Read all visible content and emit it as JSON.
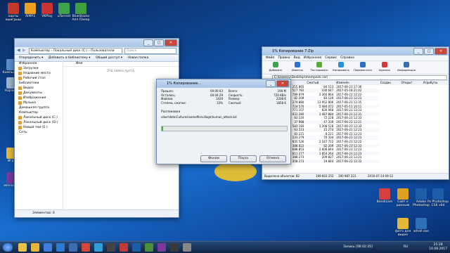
{
  "desktop": {
    "icons": [
      {
        "label": "карты выигрыш",
        "color": "#c0392b"
      },
      {
        "label": "Компьютер",
        "color": "#5b8dc9"
      },
      {
        "label": "Корзина",
        "color": "#9db3c9"
      },
      {
        "label": "AIMP3",
        "color": "#f0a020"
      },
      {
        "label": "VKPlay",
        "color": "#cc3333"
      },
      {
        "label": "uTorrent",
        "color": "#3fa34d"
      },
      {
        "label": "BlueStacks Апп Плеер",
        "color": "#3f9f3f"
      },
      {
        "label": "wtrell.exe",
        "color": "#2d6fb8"
      },
      {
        "label": "Bandicam",
        "color": "#d43f3f"
      },
      {
        "label": "Сайт к данным",
        "color": "#e0a020"
      },
      {
        "label": "Adobe Photoshop",
        "color": "#1d5ea8"
      },
      {
        "label": "Ps Photoshop CS6 x64",
        "color": "#1d5ea8"
      },
      {
        "label": "winrar.exe",
        "color": "#7a3a9a"
      },
      {
        "label": "фото для видео",
        "color": "#e4b73a"
      },
      {
        "label": "Игры",
        "color": "#e4b73a"
      }
    ]
  },
  "explorer": {
    "address": "Компьютер › Локальный диск (C:) › Пользователи",
    "search_placeholder": "Поиск",
    "cmd": {
      "organize": "Упорядочить ▾",
      "library": "Добавить в библиотеку ▾",
      "share": "Общий доступ ▾",
      "new_folder": "Новая папка"
    },
    "nav": [
      {
        "label": "Избранное",
        "header": true
      },
      {
        "label": "Загрузки",
        "header": false
      },
      {
        "label": "Недавние места",
        "header": false
      },
      {
        "label": "Рабочий стол",
        "header": false
      },
      {
        "label": "Библиотеки",
        "header": true
      },
      {
        "label": "Видео",
        "header": false
      },
      {
        "label": "Документы",
        "header": false
      },
      {
        "label": "Изображения",
        "header": false
      },
      {
        "label": "Музыка",
        "header": false
      },
      {
        "label": "Домашняя группа",
        "header": true
      },
      {
        "label": "Компьютер",
        "header": true
      },
      {
        "label": "Локальный диск (C:)",
        "header": false
      },
      {
        "label": "Локальный диск (D:)",
        "header": false
      },
      {
        "label": "Новый том (E:)",
        "header": false
      },
      {
        "label": "Сеть",
        "header": true
      }
    ],
    "col_name": "Имя",
    "empty_text": "Эта папка пуста.",
    "status": "Элементов: 0"
  },
  "copy_dialog": {
    "title": "1% Копирование...",
    "left_rows": [
      [
        "Прошло:",
        "00:00:03"
      ],
      [
        "Осталось:",
        "00:04:29"
      ],
      [
        "Файлов:",
        "1429"
      ],
      [
        "Степень сжатия:",
        "33%"
      ]
    ],
    "right_rows": [
      [
        "Всего:",
        "190 M"
      ],
      [
        "Скорость:",
        "720 KB/s"
      ],
      [
        "Размер:",
        "2208 K"
      ],
      [
        "Сжатый:",
        "1858 K"
      ]
    ],
    "unpack_label": "Распаковка",
    "file_path": "viber\\data\\Cultures\\somefile\\village\\human_attack.bd",
    "progress": 0.01,
    "buttons": {
      "background": "Фоном",
      "pause": "Пауза",
      "cancel": "Отмена"
    }
  },
  "archiver": {
    "title": "1% Копирование 7-Zip",
    "menu": [
      "Файл",
      "Правка",
      "Вид",
      "Избранное",
      "Сервис",
      "Справка"
    ],
    "toolbar": [
      "Добавить",
      "Извлечь",
      "Тестировать",
      "Копировать",
      "Переместить",
      "Удалить",
      "Информация"
    ],
    "path": "C:\\Users\\v\\Desktop\\mempack.rar\\",
    "columns": [
      "Имя",
      "Размер",
      "Сжатый",
      "Изменён",
      "Создан",
      "Открыт",
      "Атрибуты"
    ],
    "rows": [
      [
        "...",
        "255 865",
        "84 153",
        "2017-06-23 17:36"
      ],
      [
        "...",
        "517 782",
        "430 647",
        "2017-05-18 21:42"
      ],
      [
        "...",
        "2 789 879",
        "2 360 864",
        "2017-06-23 12:22"
      ],
      [
        "...",
        "82 209",
        "83 129",
        "2017-06-23 12:23"
      ],
      [
        "...",
        "15 274 880",
        "13 952 806",
        "2017-06-23 12:35"
      ],
      [
        "...",
        "5 724 570",
        "5 484 072",
        "2017-05-11 10:11"
      ],
      [
        "...",
        "771 107",
        "830 948",
        "2017-06-23 12:23"
      ],
      [
        "...",
        "10 433 280",
        "3 487 884",
        "2017-06-23 12:31"
      ],
      [
        "...",
        "83 220",
        "72 228",
        "2017-06-23 12:33"
      ],
      [
        "...",
        "37 988",
        "47 339",
        "2017-06-23 12:21"
      ],
      [
        "...",
        "1 583 184",
        "1 208 518",
        "2017-06-23 12:33"
      ],
      [
        "...",
        "63 223",
        "15 274",
        "2017-06-23 12:23"
      ],
      [
        "...",
        "83 221",
        "8 221",
        "2017-06-23 12:23"
      ],
      [
        "...",
        "133 279",
        "70 334",
        "2017-06-23 12:23"
      ],
      [
        "...",
        "2 625 526",
        "2 547 722",
        "2017-06-23 12:22"
      ],
      [
        "...",
        "1 388 823",
        "82 209",
        "2017-06-23 12:33"
      ],
      [
        "...",
        "2 688 853",
        "2 608 844",
        "2017-06-23 12:23"
      ],
      [
        "...",
        "2 611 277",
        "1 854 264",
        "2017-06-23 12:23"
      ],
      [
        "...",
        "1 388 273",
        "209 827",
        "2017-06-23 12:23"
      ],
      [
        "...",
        "1 358 273",
        "19 844",
        "2017-06-23 12:33"
      ]
    ],
    "status": {
      "selected": "Выделено объектов: 82",
      "size": "199 803 252",
      "packed": "190 987 221",
      "date": "2016-07-14 09:12"
    }
  },
  "taskbar": {
    "recording": "Запись [00:02:35]",
    "time": "21:28",
    "date": "10.08.2017",
    "lang": "RU"
  }
}
